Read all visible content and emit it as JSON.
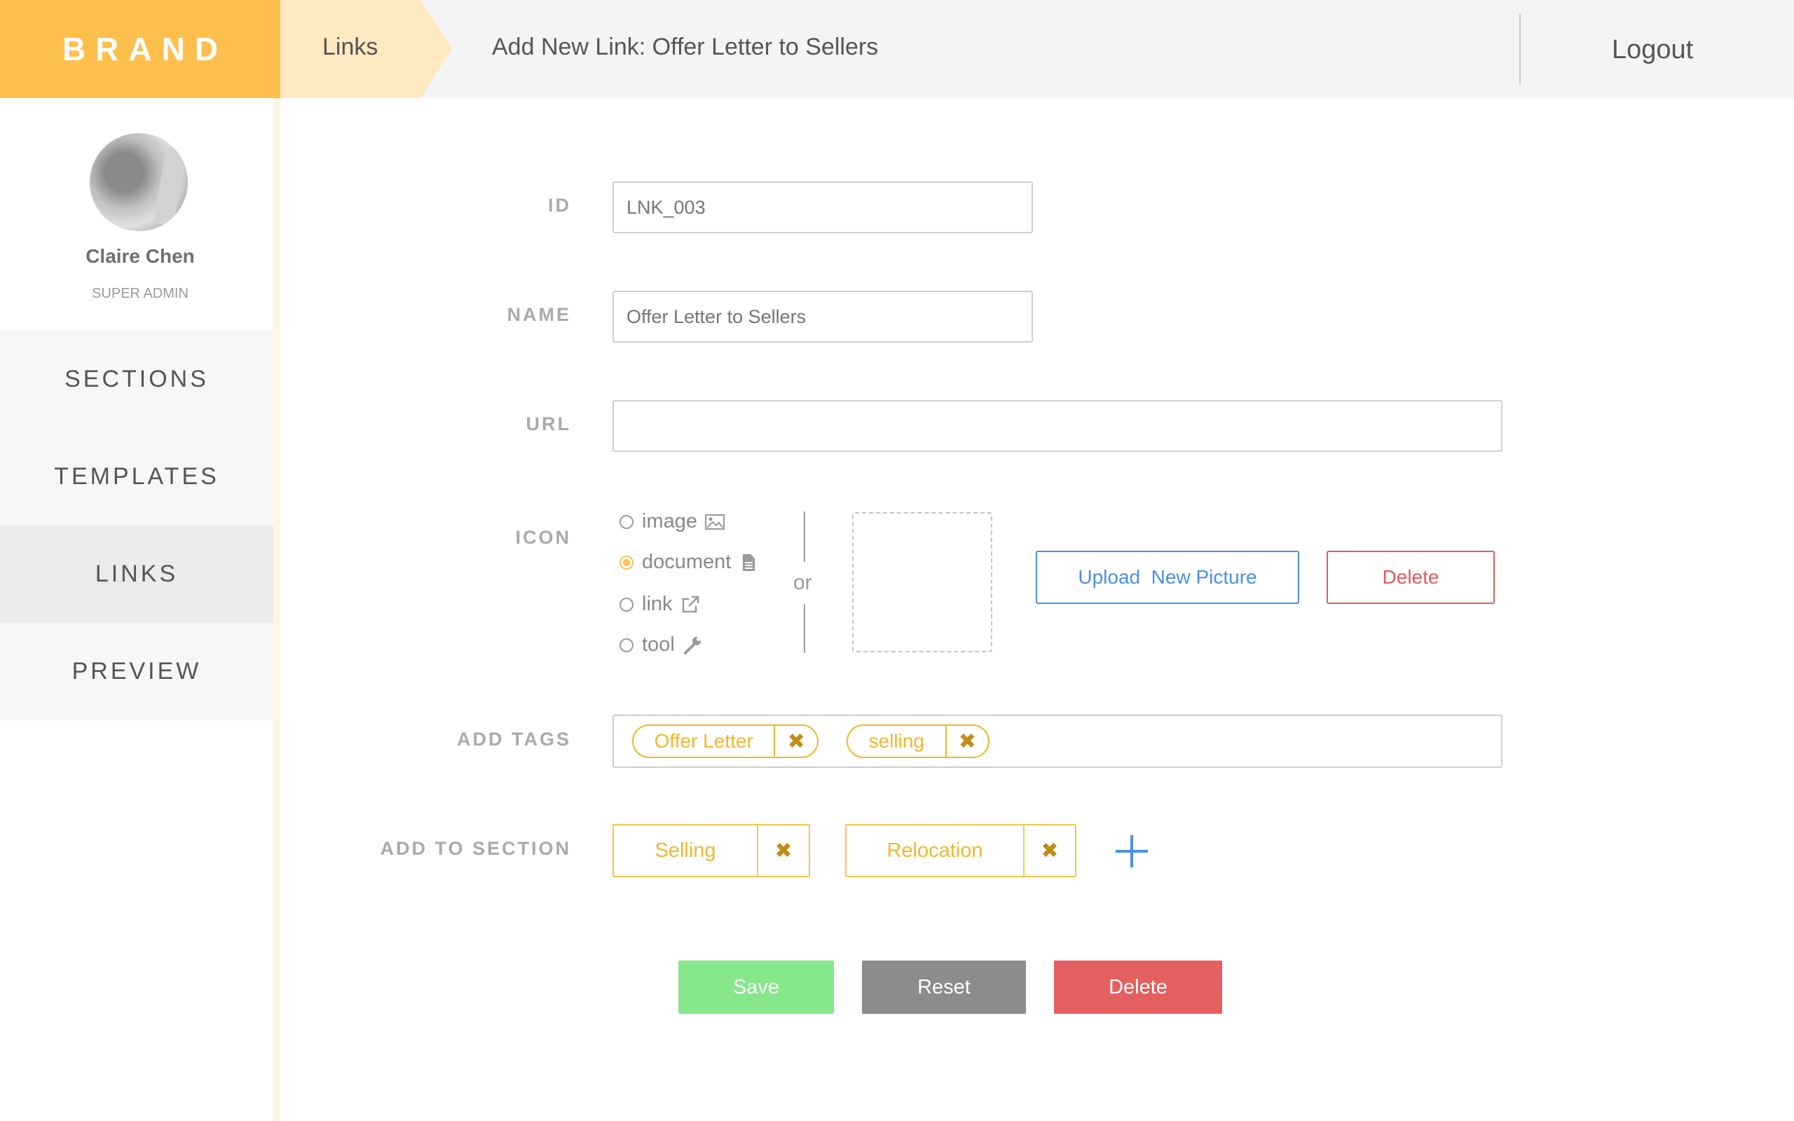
{
  "brand": {
    "name": "BRAND",
    "color": "#ffbf4d"
  },
  "header": {
    "breadcrumb": "Links",
    "title": "Add New Link: Offer Letter to Sellers",
    "logout": "Logout"
  },
  "user": {
    "name": "Claire Chen",
    "role": "SUPER ADMIN",
    "avatar_icon": "user-avatar-photo"
  },
  "sidebar": {
    "items": [
      {
        "label": "SECTIONS",
        "active": false
      },
      {
        "label": "TEMPLATES",
        "active": false
      },
      {
        "label": "LINKS",
        "active": true
      },
      {
        "label": "PREVIEW",
        "active": false
      }
    ]
  },
  "form": {
    "id": {
      "label": "ID",
      "placeholder": "LNK_003"
    },
    "name": {
      "label": "NAME",
      "placeholder": "Offer Letter to Sellers"
    },
    "url": {
      "label": "URL",
      "value": ""
    },
    "icon": {
      "label": "ICON",
      "options": [
        {
          "label": "image",
          "icon": "image-icon",
          "selected": false
        },
        {
          "label": "document",
          "icon": "document-icon",
          "selected": true
        },
        {
          "label": "link",
          "icon": "external-link-icon",
          "selected": false
        },
        {
          "label": "tool",
          "icon": "wrench-icon",
          "selected": false
        }
      ],
      "or_text": "or",
      "upload_button": "Upload  New Picture",
      "delete_button": "Delete"
    },
    "tags": {
      "label": "ADD TAGS",
      "items": [
        "Offer Letter",
        "selling"
      ],
      "remove_glyph": "✖"
    },
    "sections": {
      "label": "ADD TO SECTION",
      "items": [
        "Selling",
        "Relocation"
      ],
      "remove_glyph": "✖"
    }
  },
  "actions": {
    "save": "Save",
    "reset": "Reset",
    "delete": "Delete"
  },
  "colors": {
    "accent": "#ffbf4d",
    "tag": "#f2b630",
    "primary_blue": "#4a90e2",
    "danger": "#e45f5f",
    "save_green": "#86e78c",
    "reset_gray": "#8c8c8c"
  }
}
